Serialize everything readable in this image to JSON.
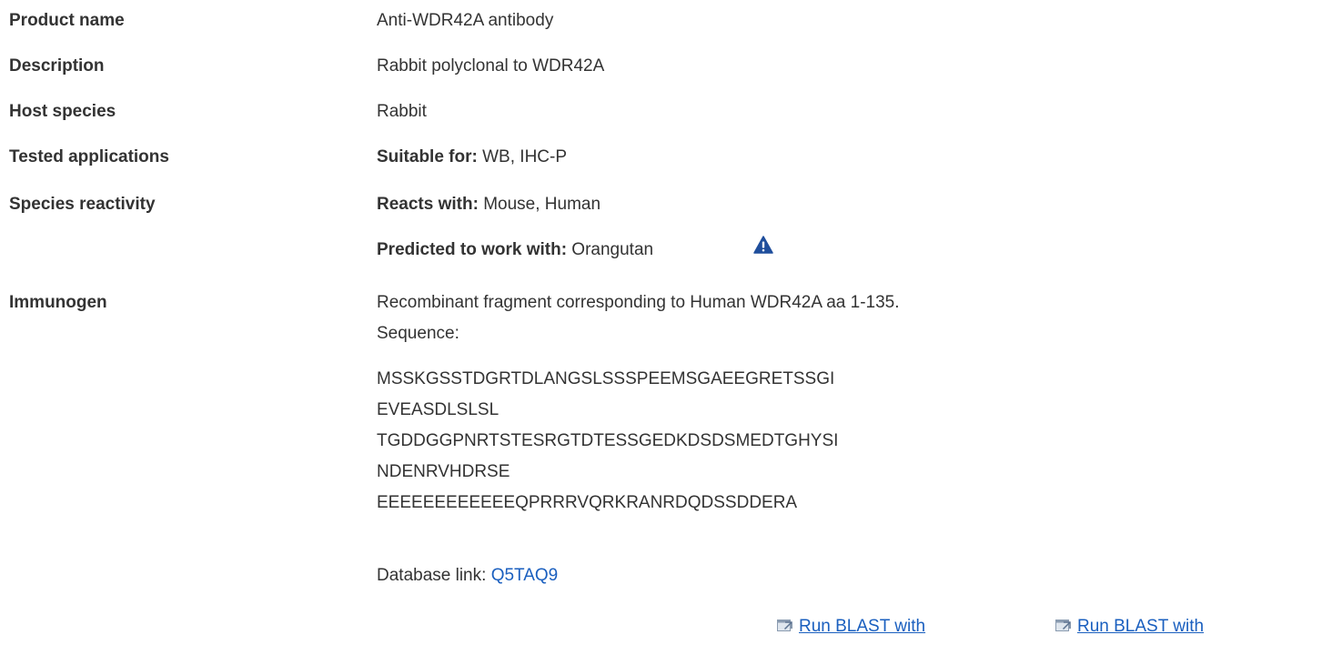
{
  "product_name": {
    "label": "Product name",
    "value": "Anti-WDR42A antibody"
  },
  "description": {
    "label": "Description",
    "value": "Rabbit polyclonal to WDR42A"
  },
  "host_species": {
    "label": "Host species",
    "value": "Rabbit"
  },
  "tested_applications": {
    "label": "Tested applications",
    "prefix": "Suitable for:",
    "value": " WB, IHC-P"
  },
  "species_reactivity": {
    "label": "Species reactivity",
    "reacts_prefix": "Reacts with:",
    "reacts_value": " Mouse, Human",
    "predicted_prefix": "Predicted to work with:",
    "predicted_value": " Orangutan",
    "warning_icon": "warning-triangle-icon",
    "warning_color": "#1f4e9c"
  },
  "immunogen": {
    "label": "Immunogen",
    "text": "Recombinant fragment corresponding to Human WDR42A aa 1-135.",
    "sequence_label": "Sequence:",
    "sequence_lines": [
      "MSSKGSSTDGRTDLANGSLSSSPEEMSGAEEGRETSSGI",
      "EVEASDLSLSL",
      "TGDDGGPNRTSTESRGTDTESSGEDKDSDSMEDTGHYSI",
      "NDENRVHDRSE",
      "EEEEEEEEEEEEQPRRRVQRKRANRDQDSSDDERA"
    ],
    "database_label": "Database link: ",
    "database_link": "Q5TAQ9",
    "blast_buttons": [
      "Run BLAST with",
      "Run BLAST with"
    ],
    "link_color": "#1a5fbf"
  }
}
